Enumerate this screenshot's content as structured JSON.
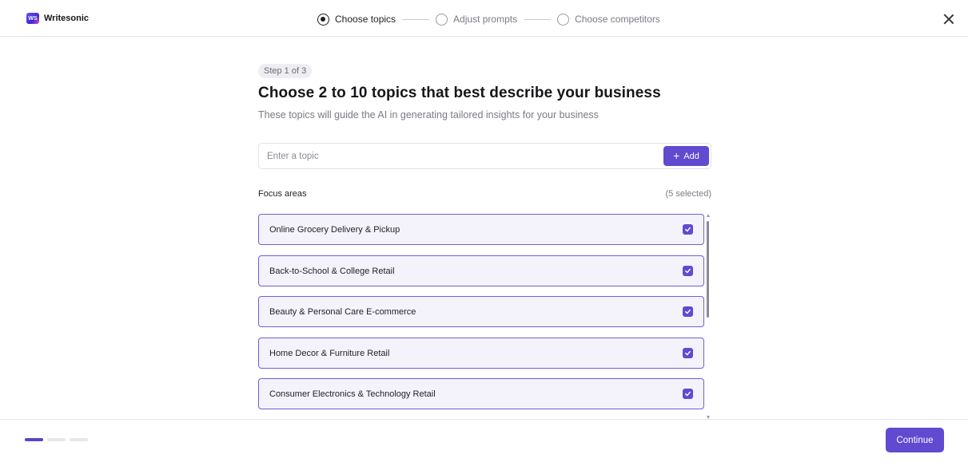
{
  "brand": {
    "name": "Writesonic",
    "logo_text": "WS",
    "icon": "writesonic-logo-icon"
  },
  "stepper": {
    "steps": [
      {
        "label": "Choose topics",
        "state": "active"
      },
      {
        "label": "Adjust prompts",
        "state": "pending"
      },
      {
        "label": "Choose competitors",
        "state": "pending"
      }
    ]
  },
  "header": {
    "close_icon": "close-icon"
  },
  "main": {
    "step_badge": "Step 1 of 3",
    "title": "Choose 2 to 10 topics that best describe your business",
    "subtitle": "These topics will guide the AI in generating tailored insights for your business",
    "topic_input": {
      "placeholder": "Enter a topic",
      "value": ""
    },
    "add_button": {
      "label": "Add",
      "icon": "plus-icon"
    },
    "focus_areas": {
      "title": "Focus areas",
      "selected_count": "(5 selected)",
      "items": [
        {
          "label": "Online Grocery Delivery & Pickup",
          "checked": true
        },
        {
          "label": "Back-to-School & College Retail",
          "checked": true
        },
        {
          "label": "Beauty & Personal Care E-commerce",
          "checked": true
        },
        {
          "label": "Home Decor & Furniture Retail",
          "checked": true
        },
        {
          "label": "Consumer Electronics & Technology Retail",
          "checked": true
        }
      ]
    }
  },
  "footer": {
    "progress": {
      "current_step": 1,
      "total_steps": 3
    },
    "continue_label": "Continue"
  },
  "colors": {
    "accent": "#6149d0",
    "card_bg": "#f4f3fc",
    "card_border": "#6f5fd4",
    "text": "#1f1f24",
    "muted": "#7a7a84"
  }
}
